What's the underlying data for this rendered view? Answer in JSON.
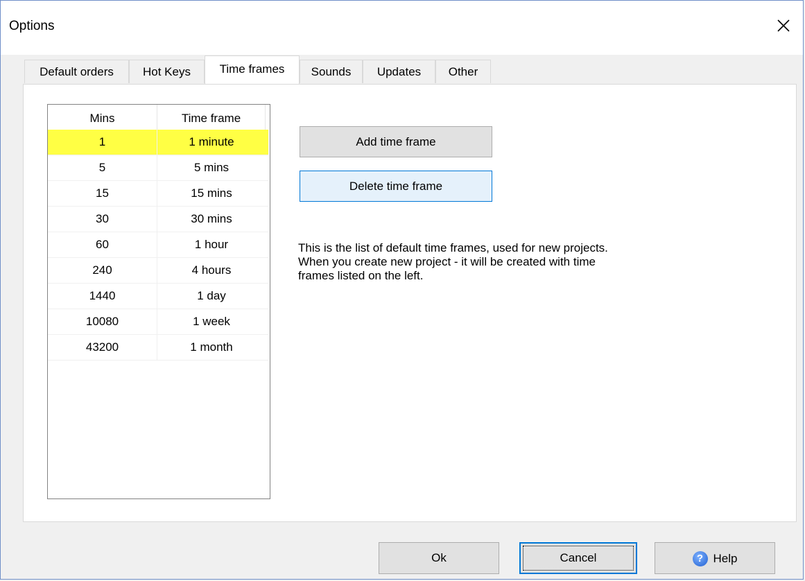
{
  "window": {
    "title": "Options",
    "close_glyph": "✕"
  },
  "tabs": [
    {
      "label": "Default orders",
      "active": false
    },
    {
      "label": "Hot Keys",
      "active": false
    },
    {
      "label": "Time frames",
      "active": true
    },
    {
      "label": "Sounds",
      "active": false
    },
    {
      "label": "Updates",
      "active": false
    },
    {
      "label": "Other",
      "active": false
    }
  ],
  "time_frames": {
    "columns": [
      "Mins",
      "Time frame"
    ],
    "rows": [
      {
        "mins": "1",
        "label": "1 minute",
        "selected": true
      },
      {
        "mins": "5",
        "label": "5 mins",
        "selected": false
      },
      {
        "mins": "15",
        "label": "15 mins",
        "selected": false
      },
      {
        "mins": "30",
        "label": "30 mins",
        "selected": false
      },
      {
        "mins": "60",
        "label": "1 hour",
        "selected": false
      },
      {
        "mins": "240",
        "label": "4 hours",
        "selected": false
      },
      {
        "mins": "1440",
        "label": "1 day",
        "selected": false
      },
      {
        "mins": "10080",
        "label": "1 week",
        "selected": false
      },
      {
        "mins": "43200",
        "label": "1 month",
        "selected": false
      }
    ],
    "add_button": "Add time frame",
    "delete_button": "Delete time frame",
    "description_lines": [
      "This is the list of default time frames, used for new projects.",
      "When you create new project - it will be created with time",
      "frames listed on the left."
    ]
  },
  "footer": {
    "ok": "Ok",
    "cancel": "Cancel",
    "help": "Help",
    "help_icon_glyph": "?"
  },
  "colors": {
    "selected_row": "#ffff44",
    "window_border": "#6f8fc8",
    "focus_border": "#0078d7"
  }
}
